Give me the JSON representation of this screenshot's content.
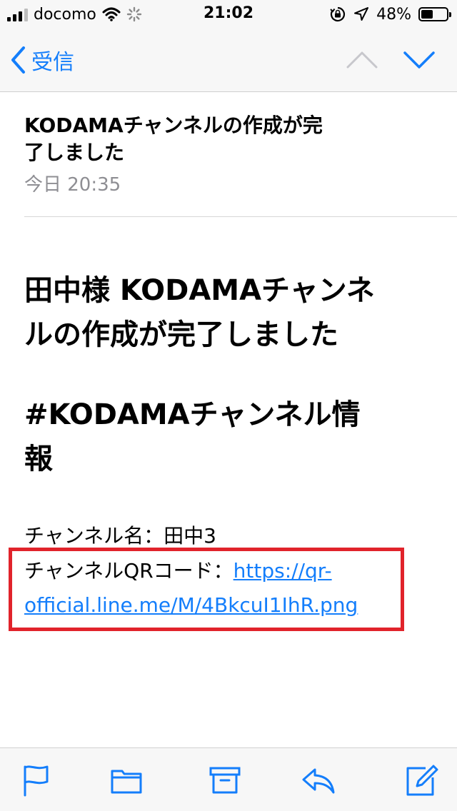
{
  "status_bar": {
    "carrier": "docomo",
    "time": "21:02",
    "battery_percent": "48%",
    "battery_level": 0.48
  },
  "nav": {
    "back_label": "受信",
    "back_icon": "chevron-left-icon",
    "prev_icon": "chevron-up-icon",
    "next_icon": "chevron-down-icon"
  },
  "email": {
    "subject_line1": "KODAMAチャンネルの作成が完",
    "subject_line2": "了しました",
    "date": "今日 20:35",
    "body": {
      "heading_line1": "田中様 KODAMAチャンネ",
      "heading_line2": "ルの作成が完了しました",
      "section_line1": "#KODAMAチャンネル情",
      "section_line2": "報",
      "channel_name": "チャンネル名：田中3",
      "qr_label": "チャンネルQRコード：",
      "qr_link_line1": "https://qr-",
      "qr_link_line2": "official.line.me/M/4BkcuI1IhR.png"
    }
  },
  "colors": {
    "accent": "#147efb",
    "highlight": "#e1232b",
    "secondary_text": "#8e8e93",
    "bar_background": "#f7f7f7"
  },
  "toolbar": {
    "icons": [
      "flag-icon",
      "folder-icon",
      "archive-icon",
      "reply-icon",
      "compose-icon"
    ]
  }
}
